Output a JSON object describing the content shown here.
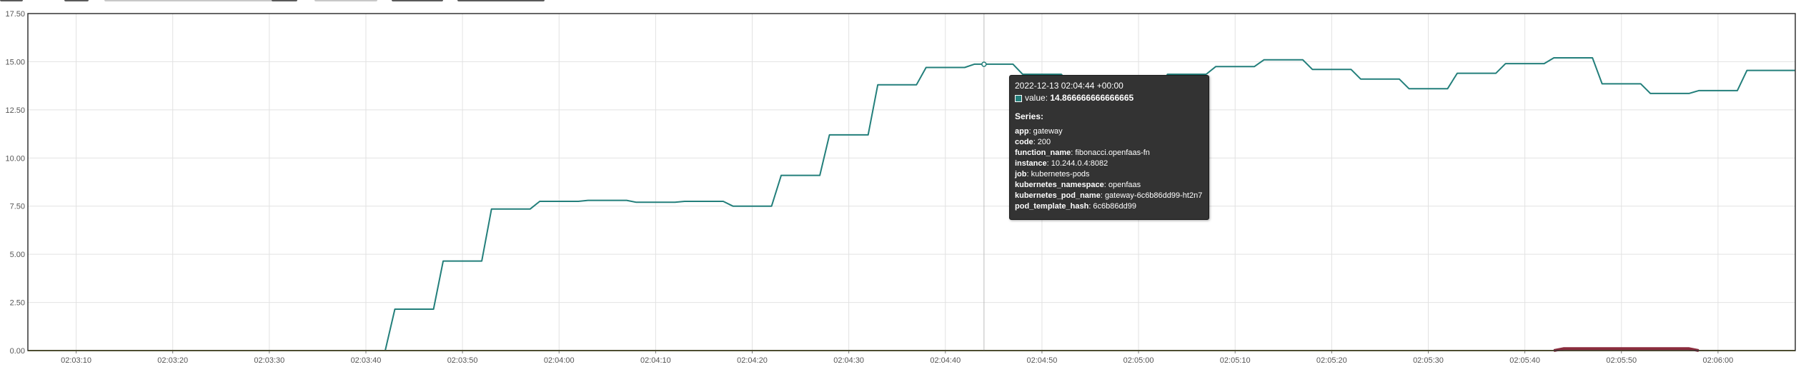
{
  "colors": {
    "series_main": "#237f7b",
    "series_zero_base": "#9c9c2c",
    "series_red": "#8b2c3d",
    "axis": "#333333",
    "grid": "#e2e2e2"
  },
  "chart_data": {
    "type": "line",
    "title": "",
    "xlabel": "",
    "ylabel": "",
    "x_is_time": true,
    "xlim": [
      "02:03:05",
      "02:06:08"
    ],
    "ylim": [
      0,
      17.5
    ],
    "y_ticks": [
      "0.00",
      "2.50",
      "5.00",
      "7.50",
      "10.00",
      "12.50",
      "15.00",
      "17.50"
    ],
    "x_ticks": [
      "02:03:10",
      "02:03:20",
      "02:03:30",
      "02:03:40",
      "02:03:50",
      "02:04:00",
      "02:04:10",
      "02:04:20",
      "02:04:30",
      "02:04:40",
      "02:04:50",
      "02:05:00",
      "02:05:10",
      "02:05:20",
      "02:05:30",
      "02:05:40",
      "02:05:50",
      "02:06:00"
    ],
    "grid": true,
    "series": [
      {
        "name": "",
        "color": "#237f7b",
        "points": [
          [
            "02:03:05",
            0
          ],
          [
            "02:03:42",
            0
          ],
          [
            "02:03:43",
            2.15
          ],
          [
            "02:03:47",
            2.15
          ],
          [
            "02:03:48",
            4.65
          ],
          [
            "02:03:52",
            4.65
          ],
          [
            "02:03:53",
            7.35
          ],
          [
            "02:03:57",
            7.35
          ],
          [
            "02:03:58",
            7.75
          ],
          [
            "02:04:02",
            7.75
          ],
          [
            "02:04:03",
            7.8
          ],
          [
            "02:04:07",
            7.8
          ],
          [
            "02:04:08",
            7.7
          ],
          [
            "02:04:12",
            7.7
          ],
          [
            "02:04:13",
            7.75
          ],
          [
            "02:04:17",
            7.75
          ],
          [
            "02:04:18",
            7.5
          ],
          [
            "02:04:22",
            7.5
          ],
          [
            "02:04:23",
            9.1
          ],
          [
            "02:04:27",
            9.1
          ],
          [
            "02:04:28",
            11.2
          ],
          [
            "02:04:32",
            11.2
          ],
          [
            "02:04:33",
            13.8
          ],
          [
            "02:04:37",
            13.8
          ],
          [
            "02:04:38",
            14.7
          ],
          [
            "02:04:42",
            14.7
          ],
          [
            "02:04:43",
            14.87
          ],
          [
            "02:04:47",
            14.87
          ],
          [
            "02:04:48",
            14.35
          ],
          [
            "02:04:52",
            14.35
          ],
          [
            "02:04:53",
            13.8
          ],
          [
            "02:04:57",
            13.8
          ],
          [
            "02:04:58",
            13.6
          ],
          [
            "02:05:02",
            13.6
          ],
          [
            "02:05:03",
            14.35
          ],
          [
            "02:05:07",
            14.35
          ],
          [
            "02:05:08",
            14.75
          ],
          [
            "02:05:12",
            14.75
          ],
          [
            "02:05:13",
            15.1
          ],
          [
            "02:05:17",
            15.1
          ],
          [
            "02:05:18",
            14.6
          ],
          [
            "02:05:22",
            14.6
          ],
          [
            "02:05:23",
            14.1
          ],
          [
            "02:05:27",
            14.1
          ],
          [
            "02:05:28",
            13.6
          ],
          [
            "02:05:32",
            13.6
          ],
          [
            "02:05:33",
            14.4
          ],
          [
            "02:05:37",
            14.4
          ],
          [
            "02:05:38",
            14.9
          ],
          [
            "02:05:42",
            14.9
          ],
          [
            "02:05:43",
            15.2
          ],
          [
            "02:05:47",
            15.2
          ],
          [
            "02:05:48",
            13.85
          ],
          [
            "02:05:52",
            13.85
          ],
          [
            "02:05:53",
            13.35
          ],
          [
            "02:05:57",
            13.35
          ],
          [
            "02:05:58",
            13.5
          ],
          [
            "02:06:02",
            13.5
          ],
          [
            "02:06:03",
            14.55
          ],
          [
            "02:06:08",
            14.55
          ]
        ]
      },
      {
        "name": "",
        "color": "#9c9c2c",
        "points": [
          [
            "02:03:05",
            0
          ],
          [
            "02:06:08",
            0
          ]
        ]
      },
      {
        "name": "",
        "color": "#8b2c3d",
        "points": [
          [
            "02:05:43",
            0
          ],
          [
            "02:05:44",
            0.1
          ],
          [
            "02:05:57",
            0.1
          ],
          [
            "02:05:58",
            0
          ]
        ]
      }
    ],
    "hover_marker": {
      "time": "02:04:44",
      "value": 14.866666666666665
    }
  },
  "tooltip": {
    "timestamp": "2022-12-13 02:04:44 +00:00",
    "value_label": "value:",
    "value": "14.866666666666665",
    "series_title": "Series:",
    "labels": [
      {
        "key": "app",
        "value": "gateway"
      },
      {
        "key": "code",
        "value": "200"
      },
      {
        "key": "function_name",
        "value": "fibonacci.openfaas-fn"
      },
      {
        "key": "instance",
        "value": "10.244.0.4:8082"
      },
      {
        "key": "job",
        "value": "kubernetes-pods"
      },
      {
        "key": "kubernetes_namespace",
        "value": "openfaas"
      },
      {
        "key": "kubernetes_pod_name",
        "value": "gateway-6c6b86dd99-ht2n7"
      },
      {
        "key": "pod_template_hash",
        "value": "6c6b86dd99"
      }
    ]
  }
}
